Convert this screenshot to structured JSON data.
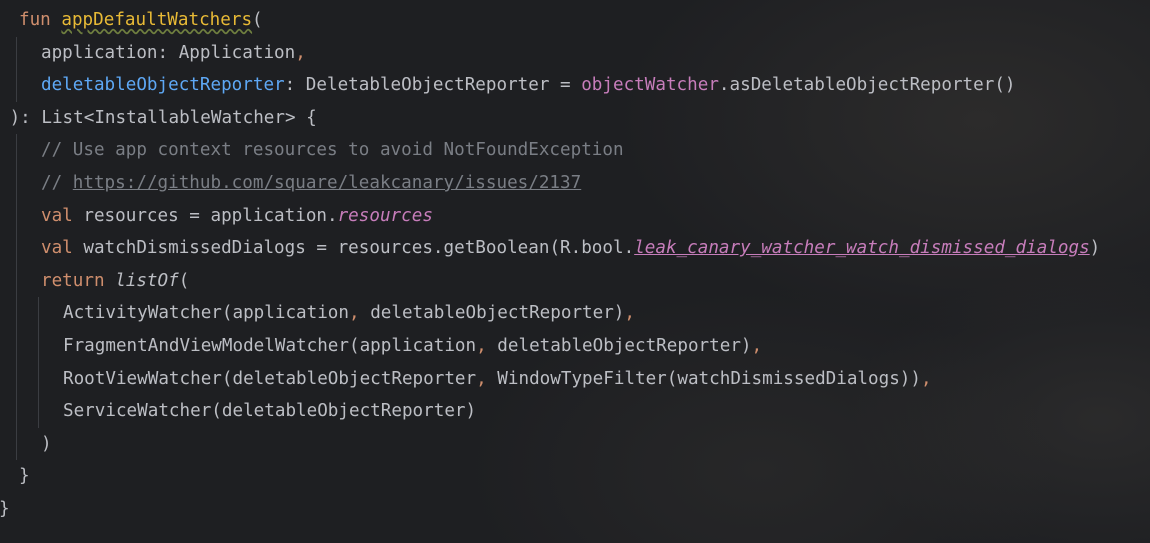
{
  "editor": {
    "lines": [
      {
        "indent": 1,
        "tokens": [
          {
            "t": "fun ",
            "c": "kw"
          },
          {
            "t": "appDefaultWatchers",
            "c": "warn-decl"
          },
          {
            "t": "(",
            "c": "plain"
          }
        ]
      },
      {
        "indent": 2,
        "tokens": [
          {
            "t": "application",
            "c": "plain"
          },
          {
            "t": ": Application",
            "c": "plain"
          },
          {
            "t": ",",
            "c": "punct-o"
          }
        ]
      },
      {
        "indent": 2,
        "tokens": [
          {
            "t": "deletableObjectReporter",
            "c": "param"
          },
          {
            "t": ": DeletableObjectReporter = ",
            "c": "plain"
          },
          {
            "t": "objectWatcher",
            "c": "prop"
          },
          {
            "t": ".asDeletableObjectReporter()",
            "c": "plain"
          }
        ]
      },
      {
        "indent": 0,
        "tokens": [
          {
            "t": " ): List<InstallableWatcher> {",
            "c": "plain"
          }
        ]
      },
      {
        "indent": 2,
        "tokens": [
          {
            "t": "// Use app context resources to avoid NotFoundException",
            "c": "comment"
          }
        ]
      },
      {
        "indent": 2,
        "tokens": [
          {
            "t": "// ",
            "c": "comment"
          },
          {
            "t": "https://github.com/square/leakcanary/issues/2137",
            "c": "link"
          }
        ]
      },
      {
        "indent": 2,
        "tokens": [
          {
            "t": "val ",
            "c": "kw"
          },
          {
            "t": "resources = application.",
            "c": "plain"
          },
          {
            "t": "resources",
            "c": "prop-it"
          }
        ]
      },
      {
        "indent": 2,
        "tokens": [
          {
            "t": "val ",
            "c": "kw"
          },
          {
            "t": "watchDismissedDialogs = resources.getBoolean(R.bool.",
            "c": "plain"
          },
          {
            "t": "leak_canary_watcher_watch_dismissed_dialogs",
            "c": "res-link"
          },
          {
            "t": ")",
            "c": "plain"
          }
        ]
      },
      {
        "indent": 2,
        "tokens": [
          {
            "t": "return ",
            "c": "kw"
          },
          {
            "t": "listOf",
            "c": "ext-it"
          },
          {
            "t": "(",
            "c": "plain"
          }
        ]
      },
      {
        "indent": 3,
        "tokens": [
          {
            "t": "ActivityWatcher(application",
            "c": "plain"
          },
          {
            "t": ", ",
            "c": "punct-o"
          },
          {
            "t": "deletableObjectReporter)",
            "c": "plain"
          },
          {
            "t": ",",
            "c": "punct-o"
          }
        ]
      },
      {
        "indent": 3,
        "tokens": [
          {
            "t": "FragmentAndViewModelWatcher(application",
            "c": "plain"
          },
          {
            "t": ", ",
            "c": "punct-o"
          },
          {
            "t": "deletableObjectReporter)",
            "c": "plain"
          },
          {
            "t": ",",
            "c": "punct-o"
          }
        ]
      },
      {
        "indent": 3,
        "tokens": [
          {
            "t": "RootViewWatcher(deletableObjectReporter",
            "c": "plain"
          },
          {
            "t": ", ",
            "c": "punct-o"
          },
          {
            "t": "WindowTypeFilter(watchDismissedDialogs))",
            "c": "plain"
          },
          {
            "t": ",",
            "c": "punct-o"
          }
        ]
      },
      {
        "indent": 3,
        "tokens": [
          {
            "t": "ServiceWatcher(deletableObjectReporter)",
            "c": "plain"
          }
        ]
      },
      {
        "indent": 2,
        "tokens": [
          {
            "t": ")",
            "c": "plain"
          }
        ]
      },
      {
        "indent": 1,
        "tokens": [
          {
            "t": "}",
            "c": "plain"
          }
        ]
      },
      {
        "indent": 0,
        "tokens": [
          {
            "t": "}",
            "c": "plain"
          }
        ]
      }
    ]
  },
  "colors": {
    "background": "#1e1f22",
    "keyword": "#cf8e6d",
    "text": "#bcbec4",
    "parameter": "#56a8f5",
    "property": "#c77dbb",
    "comment": "#7a7e85",
    "warning_underline": "#6f7f3f"
  }
}
